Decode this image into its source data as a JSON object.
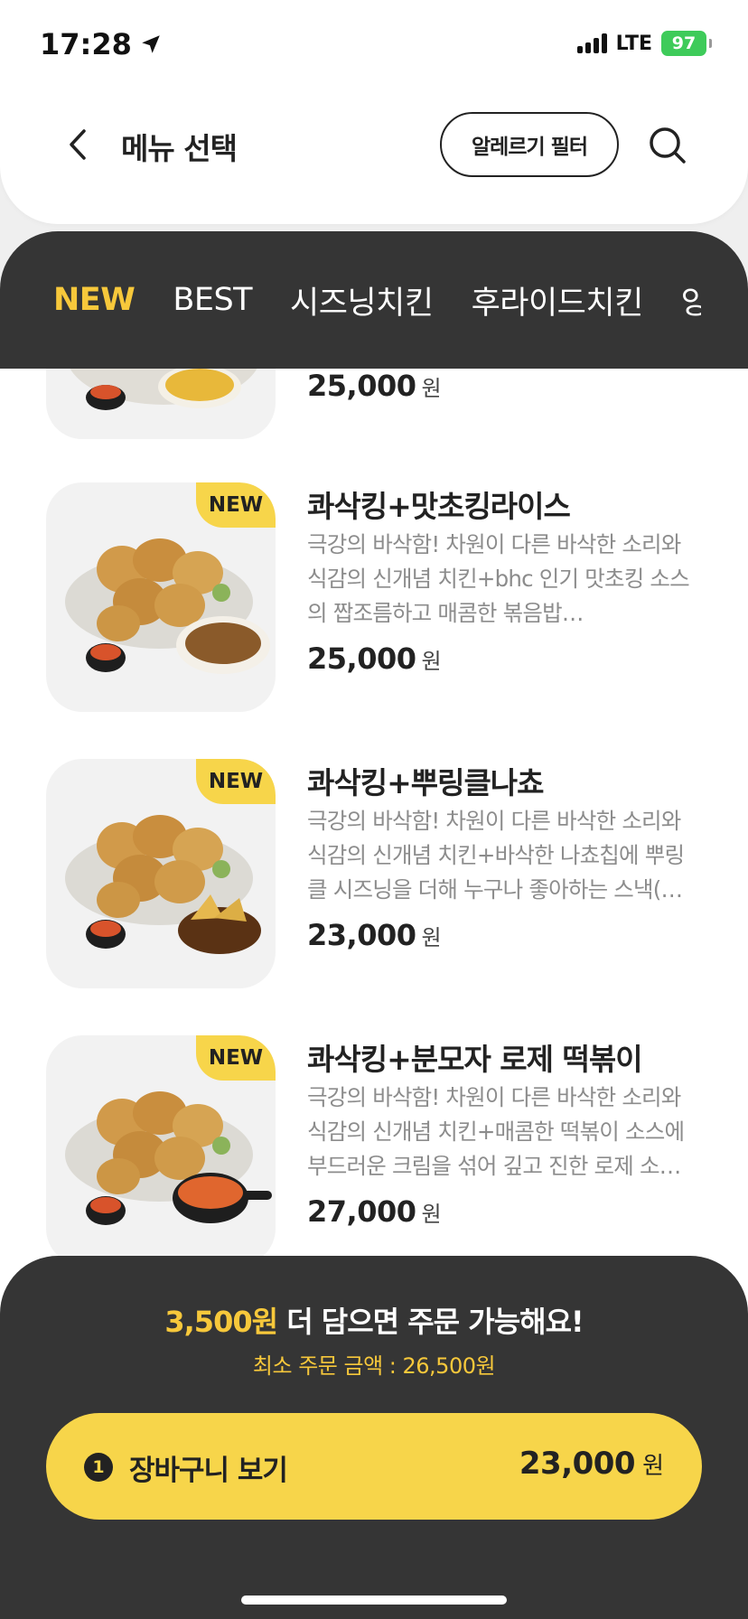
{
  "status_bar": {
    "time": "17:28",
    "location_icon": "location-arrow-icon",
    "network": "LTE",
    "battery": "97"
  },
  "header": {
    "back_icon": "chevron-left-icon",
    "title": "메뉴 선택",
    "filter_label": "알레르기 필터",
    "search_icon": "search-icon"
  },
  "tabs": [
    "NEW",
    "BEST",
    "시즈닝치킨",
    "후라이드치킨",
    "양념"
  ],
  "active_tab": "NEW",
  "menu": {
    "items": [
      {
        "name": "",
        "badge": "",
        "desc": "",
        "price": "25,000",
        "currency": "원"
      },
      {
        "name": "콰삭킹+맛초킹라이스",
        "badge": "NEW",
        "desc": "극강의 바삭함! 차원이 다른 바삭한 소리와 식감의 신개념 치킨+bhc 인기 맛초킹 소스의 짭조름하고 매콤한 볶음밥…",
        "price": "25,000",
        "currency": "원"
      },
      {
        "name": "콰삭킹+뿌링클나쵸",
        "badge": "NEW",
        "desc": "극강의 바삭함! 차원이 다른 바삭한 소리와 식감의 신개념 치킨+바삭한 나쵸칩에 뿌링클 시즈닝을 더해 누구나 좋아하는 스낵(…",
        "price": "23,000",
        "currency": "원"
      },
      {
        "name": "콰삭킹+분모자 로제 떡볶이",
        "badge": "NEW",
        "desc": "극강의 바삭함! 차원이 다른 바삭한 소리와 식감의 신개념 치킨+매콤한 떡볶이 소스에 부드러운 크림을 섞어 깊고 진한 로제 소…",
        "price": "27,000",
        "currency": "원"
      }
    ]
  },
  "order": {
    "remaining_amount": "3,500원",
    "remaining_text": " 더 담으면 주문 가능해요!",
    "min_order": "최소 주문 금액 : 26,500원",
    "cart_count": "1",
    "cart_label": "장바구니 보기",
    "cart_total": "23,000",
    "currency": "원"
  },
  "colors": {
    "accent_yellow": "#f7d54a",
    "tab_active": "#f7c83b",
    "dark_panel": "#353535",
    "battery_green": "#3ecb5a"
  }
}
